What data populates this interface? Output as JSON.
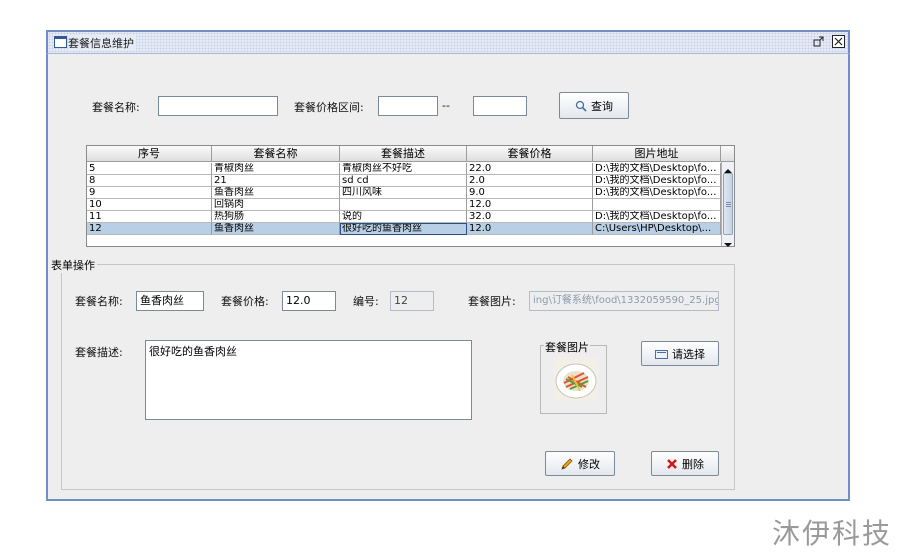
{
  "window": {
    "title": "套餐信息维护",
    "restore_glyph": "ᵒ",
    "close_glyph": "☒"
  },
  "search": {
    "name_label": "套餐名称:",
    "name_value": "",
    "price_range_label": "套餐价格区间:",
    "price_from": "",
    "separator": "--",
    "price_to": "",
    "query_button": "查询"
  },
  "table": {
    "columns": [
      "序号",
      "套餐名称",
      "套餐描述",
      "套餐价格",
      "图片地址"
    ],
    "rows": [
      [
        "5",
        "青椒肉丝",
        "青椒肉丝不好吃",
        "22.0",
        "D:\\我的文档\\Desktop\\fo..."
      ],
      [
        "8",
        "21",
        "sd cd",
        "2.0",
        "D:\\我的文档\\Desktop\\fo..."
      ],
      [
        "9",
        "鱼香肉丝",
        "四川风味",
        "9.0",
        "D:\\我的文档\\Desktop\\fo..."
      ],
      [
        "10",
        "回锅肉",
        "",
        "12.0",
        ""
      ],
      [
        "11",
        "热狗肠",
        "说的",
        "32.0",
        "D:\\我的文档\\Desktop\\fo..."
      ],
      [
        "12",
        "鱼香肉丝",
        "很好吃的鱼香肉丝",
        "12.0",
        "C:\\Users\\HP\\Desktop\\..."
      ]
    ],
    "selected_index": 5
  },
  "form": {
    "group_title": "表单操作",
    "name_label": "套餐名称:",
    "name_value": "鱼香肉丝",
    "price_label": "套餐价格:",
    "price_value": "12.0",
    "id_label": "编号:",
    "id_value": "12",
    "image_label": "套餐图片:",
    "image_path": "ing\\订餐系统\\food\\1332059590_25.jpg",
    "desc_label": "套餐描述:",
    "desc_value": "很好吃的鱼香肉丝",
    "image_box_title": "套餐图片",
    "choose_button": "请选择",
    "edit_button": "修改",
    "delete_button": "删除"
  },
  "watermark": "沐伊科技",
  "colors": {
    "frame_border": "#6f8fc5",
    "selection": "#b8cfe5",
    "delete_red": "#cc1a1a",
    "edit_orange": "#e8a317"
  }
}
